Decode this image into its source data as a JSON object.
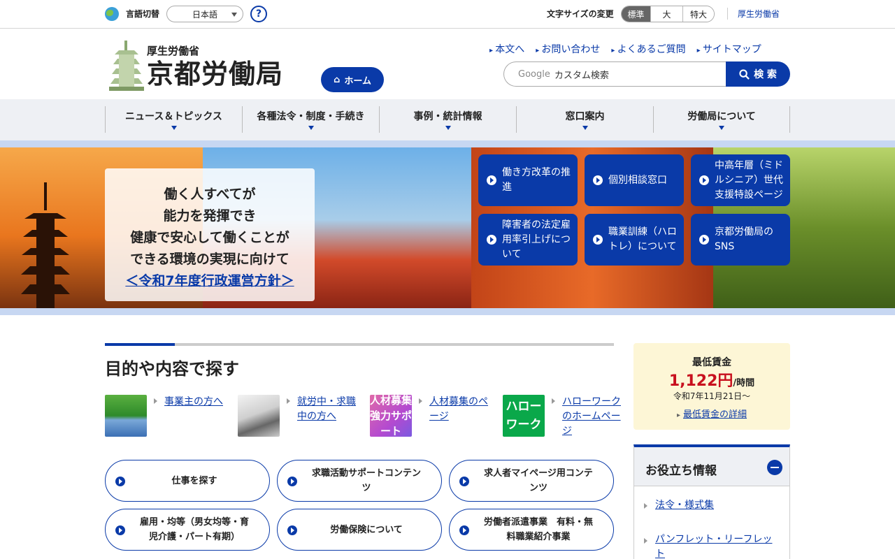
{
  "topbar": {
    "lang_label": "言語切替",
    "lang_selected": "日本語",
    "help": "?",
    "fontsize_label": "文字サイズの変更",
    "fontsize_options": [
      "標準",
      "大",
      "特大"
    ],
    "mhlw_link": "厚生労働省"
  },
  "header": {
    "logo_sub": "厚生労働省",
    "logo_main": "京都労働局",
    "home_label": "ホーム",
    "util_links": [
      "本文へ",
      "お問い合わせ",
      "よくあるご質問",
      "サイトマップ"
    ],
    "search_brand": "Google",
    "search_placeholder": "カスタム検索",
    "search_button": "検 索"
  },
  "mainnav": {
    "items": [
      "ニュース＆トピックス",
      "各種法令・制度・手続き",
      "事例・統計情報",
      "窓口案内",
      "労働局について"
    ]
  },
  "hero": {
    "lines": [
      "働く人すべてが",
      "能力を発揮でき",
      "健康で安心して働くことが",
      "できる環境の実現に向けて"
    ],
    "link": "＜令和7年度行政運営方針＞",
    "buttons": [
      "働き方改革の推進",
      "個別相談窓口",
      "中高年層（ミドルシニア）世代支援特設ページ",
      "障害者の法定雇用率引上げについて",
      "職業訓練（ハロトレ）について",
      "京都労働局のSNS"
    ]
  },
  "section": {
    "title": "目的や内容で探す",
    "tiles": [
      {
        "label": "事業主の方へ",
        "img_text": ""
      },
      {
        "label": "就労中・求職中の方へ",
        "img_text": ""
      },
      {
        "label": "人材募集のページ",
        "img_text": "人材募集強力サポート"
      },
      {
        "label": "ハローワークのホームページ",
        "img_text": "ハローワーク"
      }
    ],
    "pills": [
      "仕事を探す",
      "求職活動サポートコンテンツ",
      "求人者マイページ用コンテンツ",
      "雇用・均等（男女均等・育児介護・パート有期）",
      "労働保険について",
      "労働者派遣事業　有料・無料職業紹介事業"
    ]
  },
  "wage": {
    "title": "最低賃金",
    "amount": "1,122円",
    "unit": "/時間",
    "date": "令和7年11月21日～",
    "link": "最低賃金の詳細"
  },
  "useful": {
    "title": "お役立ち情報",
    "items": [
      "法令・様式集",
      "パンフレット・リーフレット"
    ]
  },
  "colors": {
    "primary": "#0a3aa8",
    "wage_red": "#c8101e",
    "nav_bg": "#eef0f4",
    "accent_bar": "#c7d7f2"
  }
}
